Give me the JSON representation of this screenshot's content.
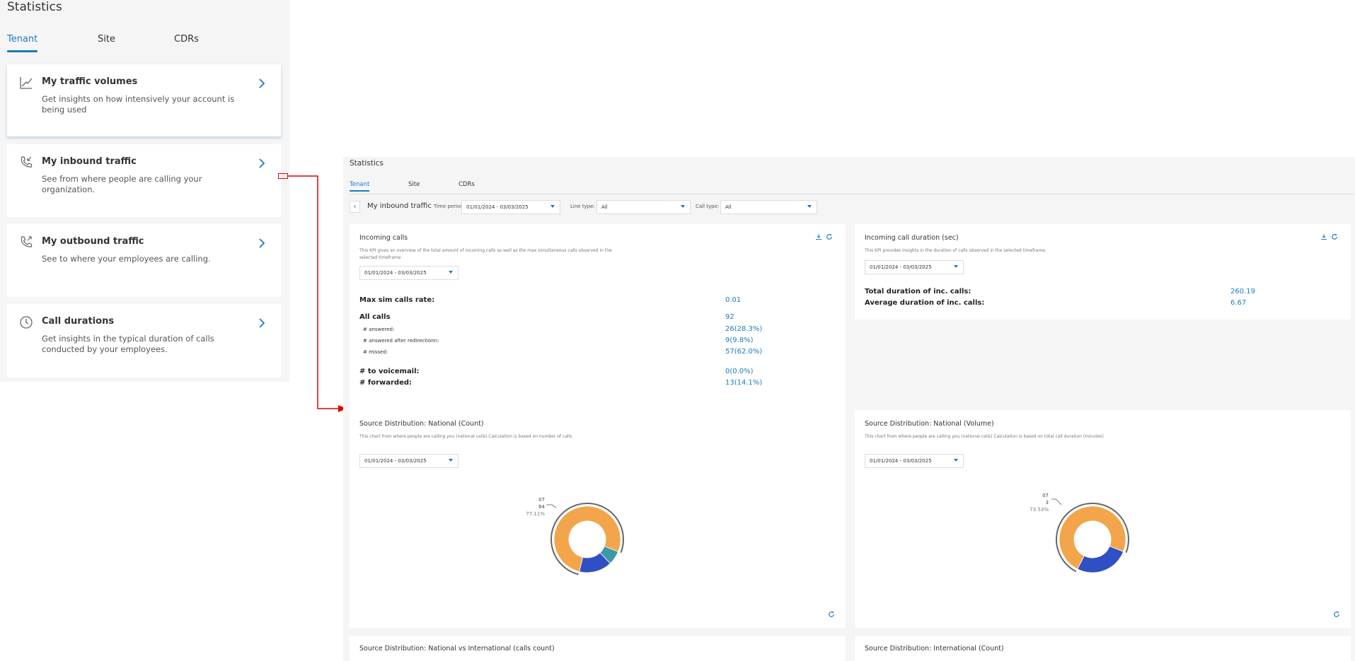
{
  "left": {
    "title": "Statistics",
    "tabs": [
      {
        "label": "Tenant"
      },
      {
        "label": "Site"
      },
      {
        "label": "CDRs"
      }
    ],
    "cards": [
      {
        "title": "My traffic volumes",
        "desc": "Get insights on how intensively your account is being used",
        "icon": "chart-line-icon"
      },
      {
        "title": "My inbound traffic",
        "desc": "See from where people are calling your organization.",
        "icon": "phone-incoming-icon"
      },
      {
        "title": "My outbound traffic",
        "desc": "See to where your employees are calling.",
        "icon": "phone-outgoing-icon"
      },
      {
        "title": "Call durations",
        "desc": "Get insights in the typical duration of calls conducted by your employees.",
        "icon": "clock-icon"
      }
    ]
  },
  "annotation_color": "#e00000",
  "right": {
    "title": "Statistics",
    "tabs": [
      {
        "label": "Tenant"
      },
      {
        "label": "Site"
      },
      {
        "label": "CDRs"
      }
    ],
    "filters": {
      "page_title": "My inbound traffic",
      "time_period_label": "Time period:",
      "time_period_value": "01/01/2024 - 03/03/2025",
      "line_type_label": "Line type:",
      "line_type_value": "All",
      "call_type_label": "Call type:",
      "call_type_value": "All"
    },
    "incoming_calls": {
      "title": "Incoming calls",
      "desc": "This KPI gives an overview of the total amount of incoming calls as well as the max simultaneous calls observed in the selected timeframe",
      "date": "01/01/2024 - 03/03/2025",
      "max_sim_label": "Max sim calls rate:",
      "max_sim_value": "0.01",
      "all_calls_label": "All calls",
      "all_calls_value": "92",
      "answered_label": "# answered:",
      "answered_value": "26(28.3%)",
      "answered_redir_label": "# answered after redirectionn:",
      "answered_redir_value": "9(9.8%)",
      "missed_label": "# missed:",
      "missed_value": "57(62.0%)",
      "voicemail_label": "# to voicemail:",
      "voicemail_value": "0(0.0%)",
      "forwarded_label": "# forwarded:",
      "forwarded_value": "13(14.1%)"
    },
    "incoming_duration": {
      "title": "Incoming call duration (sec)",
      "desc": "This KPI provides insights in the duration of calls observed in the selected timeframe.",
      "date": "01/01/2024 - 03/03/2025",
      "total_label": "Total duration of inc. calls:",
      "total_value": "260.19",
      "avg_label": "Average duration of inc. calls:",
      "avg_value": "6.67"
    },
    "national_count": {
      "title": "Source Distribution: National (Count)",
      "desc": "This chart from where people are calling you (national calls) Calculation is based on number of calls",
      "date": "01/01/2024 - 03/03/2025",
      "callout": {
        "line1": "07",
        "line2": "64",
        "line3": "77.11%"
      }
    },
    "national_volume": {
      "title": "Source Distribution: National (Volume)",
      "desc": "This chart from where people are calling you (national calls) Calculation is based on total call duration (minutes)",
      "date": "01/01/2024 - 03/03/2025",
      "callout": {
        "line1": "07",
        "line2": "3",
        "line3": "73.53%"
      }
    },
    "bottom_left_title": "Source Distribution: National vs International (calls count)",
    "bottom_right_title": "Source Distribution: International (Count)"
  },
  "chart_data": [
    {
      "type": "pie",
      "title": "Source Distribution: National (Count)",
      "slices": [
        {
          "label": "07",
          "value": 77.11,
          "color": "#f2a54a"
        },
        {
          "label": "",
          "value": 16.0,
          "color": "#2f4fc4"
        },
        {
          "label": "",
          "value": 6.89,
          "color": "#3b9aa3"
        }
      ]
    },
    {
      "type": "pie",
      "title": "Source Distribution: National (Volume)",
      "slices": [
        {
          "label": "07",
          "value": 73.53,
          "color": "#f2a54a"
        },
        {
          "label": "",
          "value": 26.47,
          "color": "#2f4fc4"
        }
      ]
    }
  ]
}
